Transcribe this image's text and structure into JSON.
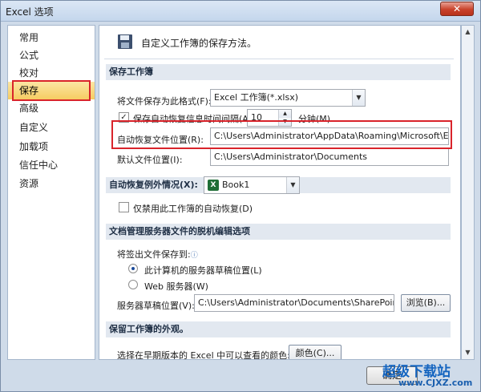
{
  "window": {
    "title": "Excel 选项",
    "close_glyph": "✕"
  },
  "sidebar": {
    "items": [
      {
        "label": "常用"
      },
      {
        "label": "公式"
      },
      {
        "label": "校对"
      },
      {
        "label": "保存",
        "selected": true
      },
      {
        "label": "高级"
      },
      {
        "label": "自定义"
      },
      {
        "label": "加载项"
      },
      {
        "label": "信任中心"
      },
      {
        "label": "资源"
      }
    ]
  },
  "main": {
    "header_text": "自定义工作簿的保存方法。",
    "save_section": {
      "title": "保存工作簿",
      "format_label": "将文件保存为此格式(F):",
      "format_value": "Excel 工作簿(*.xlsx)",
      "autorecover_check_label": "保存自动恢复信息时间间隔(A)",
      "autorecover_checked": true,
      "interval_value": "10",
      "minutes_label": "分钟(M)",
      "autorecover_location_label": "自动恢复文件位置(R):",
      "autorecover_location_value": "C:\\Users\\Administrator\\AppData\\Roaming\\Microsoft\\Excel\\",
      "default_location_label": "默认文件位置(I):",
      "default_location_value": "C:\\Users\\Administrator\\Documents"
    },
    "exceptions_section": {
      "title": "自动恢复例外情况(X):",
      "workbook_value": "Book1",
      "disable_label": "仅禁用此工作簿的自动恢复(D)",
      "disable_checked": false
    },
    "offline_section": {
      "title": "文档管理服务器文件的脱机编辑选项",
      "save_to_label": "将签出文件保存到:",
      "radio_server_drafts": "此计算机的服务器草稿位置(L)",
      "radio_web_server": "Web 服务器(W)",
      "selected_option": "server_drafts",
      "drafts_location_label": "服务器草稿位置(V):",
      "drafts_location_value": "C:\\Users\\Administrator\\Documents\\SharePoint 草稿",
      "browse_label": "浏览(B)..."
    },
    "appearance_section": {
      "title": "保留工作簿的外观。",
      "colors_label": "选择在早期版本的 Excel 中可以查看的颜色:",
      "colors_button": "颜色(C)..."
    }
  },
  "footer": {
    "ok_label": "确定"
  },
  "watermark": {
    "line1": "超级下载站",
    "line2": "www.CJXZ.com"
  },
  "icons": {
    "save_icon": "floppy-disk-icon",
    "info_icon": "ⓘ",
    "dropdown_glyph": "▼",
    "spin_up": "▲",
    "spin_down": "▼",
    "check_glyph": "✓",
    "excel_glyph": "X"
  },
  "colors": {
    "accent": "#d9242b",
    "selection": "#f6cc61"
  }
}
